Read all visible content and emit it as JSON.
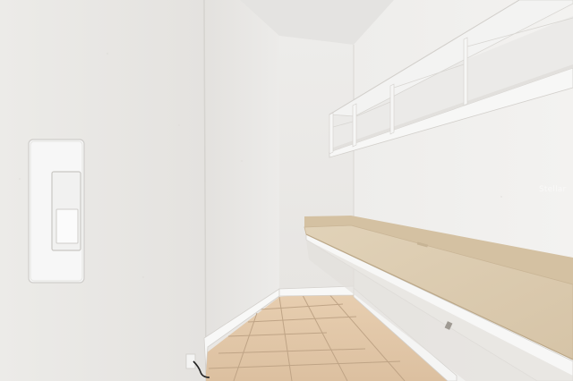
{
  "photo": {
    "watermark": "Stellar"
  },
  "colors": {
    "wall_light": "#eeedeb",
    "wall_shadow": "#dcdad7",
    "ceiling": "#e6e5e3",
    "floor_tile": "#e3c8a8",
    "grout": "#b59c80",
    "counter_top": "#dccbb0",
    "baseboard": "#f7f7f6"
  }
}
